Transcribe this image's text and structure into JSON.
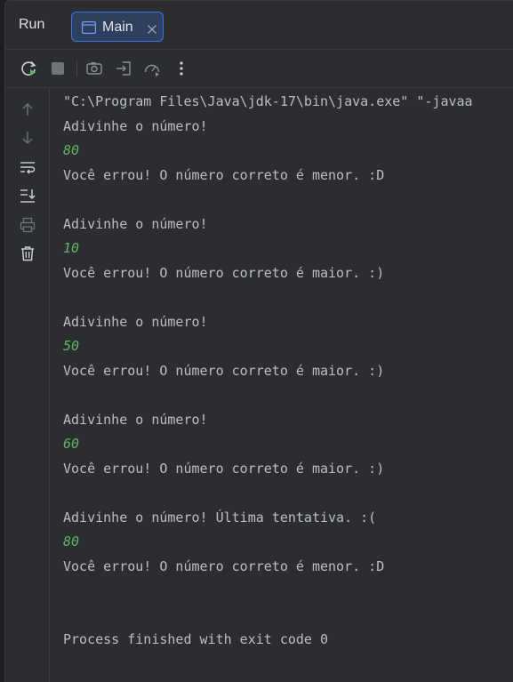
{
  "header": {
    "run_label": "Run",
    "tab_label": "Main"
  },
  "toolbar": {
    "buttons": [
      "rerun-icon",
      "stop-icon",
      "camera-icon",
      "restore-layout-icon",
      "profiler-icon",
      "more-icon"
    ]
  },
  "gutter": {
    "buttons": [
      "arrow-up-icon",
      "arrow-down-icon",
      "soft-wrap-icon",
      "scroll-to-end-icon",
      "print-icon",
      "trash-icon"
    ]
  },
  "console": {
    "command": "\"C:\\Program Files\\Java\\jdk-17\\bin\\java.exe\" \"-javaa",
    "prompt": "Adivinhe o número!",
    "last_prompt": "Adivinhe o número! Última tentativa. :(",
    "lower_msg": "Você errou! O número correto é menor. :D",
    "higher_msg": "Você errou! O número correto é maior. :)",
    "inputs": [
      "80",
      "10",
      "50",
      "60",
      "80"
    ],
    "exit": "Process finished with exit code 0"
  },
  "colors": {
    "background": "#2b2d30",
    "text": "#bcbec4",
    "user_input": "#5fb865",
    "tab_fill": "#2f3f5e",
    "tab_border": "#3574f0"
  }
}
